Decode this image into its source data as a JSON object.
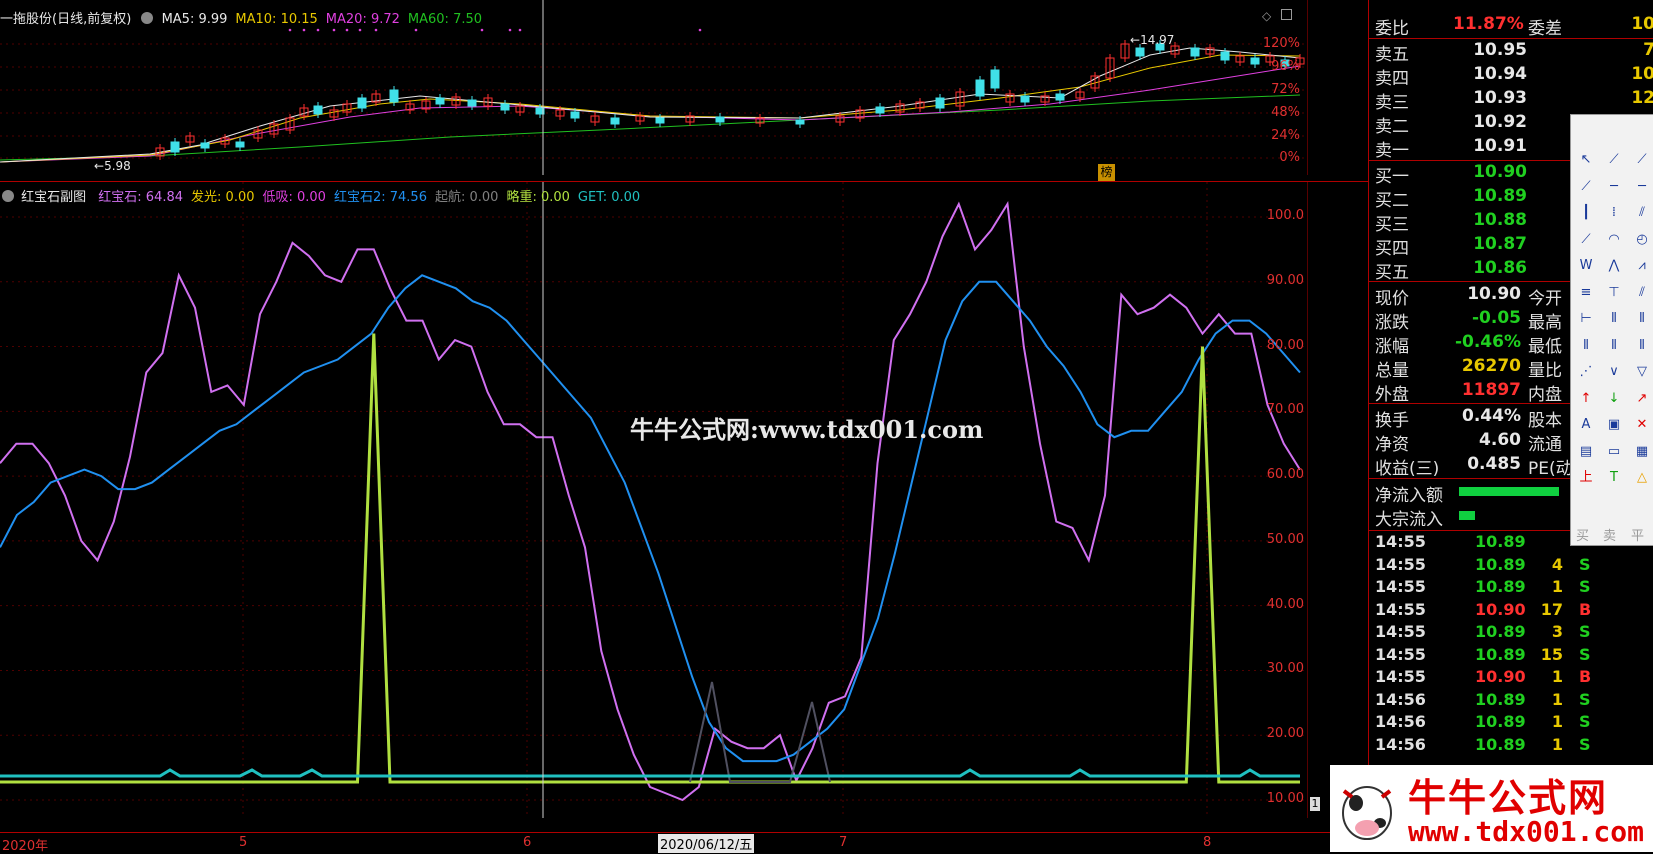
{
  "main_chart": {
    "title": "一拖股份(日线,前复权)",
    "ma": [
      {
        "label": "MA5: 9.99",
        "color": "#e8e8e8"
      },
      {
        "label": "MA10: 10.15",
        "color": "#e8c800"
      },
      {
        "label": "MA20: 9.72",
        "color": "#e040e0"
      },
      {
        "label": "MA60: 7.50",
        "color": "#20c020"
      }
    ],
    "pct_axis": [
      "120%",
      "96%",
      "72%",
      "48%",
      "24%",
      "0%"
    ],
    "high_label": "14.97",
    "low_label": "5.98",
    "bang_label": "榜"
  },
  "sub_chart": {
    "title": "红宝石副图",
    "indicators": [
      {
        "label": "红宝石: 64.84",
        "color": "#d070f0"
      },
      {
        "label": "发光: 0.00",
        "color": "#e8c800"
      },
      {
        "label": "低吸: 0.00",
        "color": "#e040e0"
      },
      {
        "label": "红宝石2: 74.56",
        "color": "#2090f0"
      },
      {
        "label": "起航: 0.00",
        "color": "#808080"
      },
      {
        "label": "略重: 0.00",
        "color": "#b0e040"
      },
      {
        "label": "GET: 0.00",
        "color": "#20c0c0"
      }
    ],
    "y_axis": [
      "100.0",
      "90.00",
      "80.00",
      "70.00",
      "60.00",
      "50.00",
      "40.00",
      "30.00",
      "20.00",
      "10.00"
    ],
    "right_marker": "1"
  },
  "x_axis": {
    "labels": [
      "2020年",
      "5",
      "6",
      "7",
      "8"
    ],
    "cursor_date": "2020/06/12/五"
  },
  "watermark_text": "牛牛公式网:www.tdx001.com",
  "chart_data": {
    "type": "line",
    "title": "红宝石副图",
    "ylim": [
      10,
      100
    ],
    "series": [
      {
        "name": "红宝石",
        "values": [
          62,
          65,
          65,
          62,
          57,
          50,
          47,
          53,
          63,
          76,
          79,
          91,
          86,
          73,
          74,
          71,
          85,
          90,
          96,
          94,
          91,
          90,
          95,
          95,
          89,
          84,
          84,
          78,
          81,
          80,
          73,
          68,
          68,
          66,
          66,
          57,
          49,
          33,
          24,
          17,
          12,
          11,
          10,
          12,
          21,
          19,
          18,
          18,
          20,
          13,
          18,
          25,
          26,
          32,
          62,
          81,
          85,
          90,
          97,
          102,
          95,
          98,
          102,
          80,
          65,
          53,
          52,
          47,
          57,
          88,
          85,
          86,
          88,
          86,
          82,
          85,
          82,
          82,
          71,
          65,
          61
        ]
      },
      {
        "name": "红宝石2",
        "values": [
          49,
          54,
          56,
          59,
          60,
          61,
          60,
          58,
          58,
          59,
          61,
          63,
          65,
          67,
          68,
          70,
          72,
          74,
          76,
          77,
          78,
          80,
          82,
          86,
          89,
          91,
          90,
          89,
          87,
          86,
          84,
          81,
          78,
          75,
          72,
          69,
          64,
          59,
          52,
          45,
          37,
          29,
          22,
          18,
          16,
          16,
          16,
          17,
          19,
          21,
          24,
          31,
          38,
          48,
          59,
          70,
          81,
          87,
          90,
          90,
          87,
          84,
          80,
          77,
          73,
          68,
          66,
          67,
          67,
          70,
          73,
          78,
          82,
          84,
          84,
          82,
          79,
          76
        ]
      },
      {
        "name": "略重",
        "values": [
          0,
          0,
          0,
          0,
          0,
          0,
          0,
          0,
          0,
          0,
          0,
          0,
          0,
          0,
          0,
          0,
          0,
          0,
          0,
          0,
          0,
          0,
          0,
          82,
          0,
          0,
          0,
          0,
          0,
          0,
          0,
          0,
          0,
          0,
          0,
          0,
          0,
          0,
          0,
          0,
          0,
          0,
          0,
          0,
          0,
          0,
          0,
          0,
          0,
          0,
          0,
          0,
          0,
          0,
          0,
          0,
          0,
          0,
          0,
          0,
          0,
          0,
          0,
          0,
          0,
          0,
          0,
          0,
          0,
          0,
          0,
          0,
          0,
          0,
          80,
          0,
          0,
          0,
          0,
          0,
          0
        ]
      }
    ]
  },
  "quote": {
    "weibi_label": "委比",
    "weibi_value": "11.87%",
    "weicha_label": "委差",
    "weicha_value": "10",
    "asks": [
      {
        "label": "卖五",
        "price": "10.95",
        "vol": "7"
      },
      {
        "label": "卖四",
        "price": "10.94",
        "vol": "10"
      },
      {
        "label": "卖三",
        "price": "10.93",
        "vol": "12"
      },
      {
        "label": "卖二",
        "price": "10.92",
        "vol": ""
      },
      {
        "label": "卖一",
        "price": "10.91",
        "vol": ""
      }
    ],
    "bids": [
      {
        "label": "买一",
        "price": "10.90"
      },
      {
        "label": "买二",
        "price": "10.89"
      },
      {
        "label": "买三",
        "price": "10.88"
      },
      {
        "label": "买四",
        "price": "10.87"
      },
      {
        "label": "买五",
        "price": "10.86"
      }
    ],
    "info": [
      {
        "l1": "现价",
        "v1": "10.90",
        "c1": "#e8e8e8",
        "l2": "今开"
      },
      {
        "l1": "涨跌",
        "v1": "-0.05",
        "c1": "#20d020",
        "l2": "最高"
      },
      {
        "l1": "涨幅",
        "v1": "-0.46%",
        "c1": "#20d020",
        "l2": "最低"
      },
      {
        "l1": "总量",
        "v1": "26270",
        "c1": "#e8c800",
        "l2": "量比"
      },
      {
        "l1": "外盘",
        "v1": "11897",
        "c1": "#ff3030",
        "l2": "内盘"
      }
    ],
    "info2": [
      {
        "l1": "换手",
        "v1": "0.44%",
        "c1": "#e8e8e8",
        "l2": "股本"
      },
      {
        "l1": "净资",
        "v1": "4.60",
        "c1": "#e8e8e8",
        "l2": "流通"
      },
      {
        "l1": "收益(三)",
        "v1": "0.485",
        "c1": "#e8e8e8",
        "l2": "PE(动)"
      }
    ],
    "flows": [
      {
        "label": "净流入额",
        "value": "-26"
      },
      {
        "label": "大宗流入",
        "value": "-6"
      }
    ],
    "ticks": [
      {
        "time": "14:55",
        "price": "10.89",
        "vol": "",
        "dir": ""
      },
      {
        "time": "14:55",
        "price": "10.89",
        "vol": "4",
        "dir": "S"
      },
      {
        "time": "14:55",
        "price": "10.89",
        "vol": "1",
        "dir": "S"
      },
      {
        "time": "14:55",
        "price": "10.90",
        "vol": "17",
        "dir": "B"
      },
      {
        "time": "14:55",
        "price": "10.89",
        "vol": "3",
        "dir": "S"
      },
      {
        "time": "14:55",
        "price": "10.89",
        "vol": "15",
        "dir": "S"
      },
      {
        "time": "14:55",
        "price": "10.90",
        "vol": "1",
        "dir": "B"
      },
      {
        "time": "14:56",
        "price": "10.89",
        "vol": "1",
        "dir": "S"
      },
      {
        "time": "14:56",
        "price": "10.89",
        "vol": "1",
        "dir": "S"
      },
      {
        "time": "14:56",
        "price": "10.89",
        "vol": "1",
        "dir": "S"
      }
    ]
  },
  "toolbox": {
    "buy_label": "买",
    "sell_label": "卖",
    "flat_label": "平"
  },
  "logo": {
    "cn": "牛牛公式网",
    "url": "www.tdx001.com"
  }
}
